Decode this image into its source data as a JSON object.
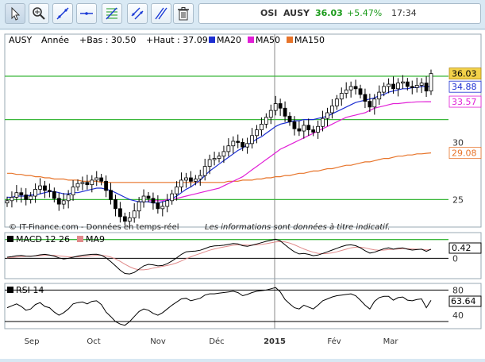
{
  "toolbar": {
    "tools": [
      {
        "name": "pointer-icon"
      },
      {
        "name": "zoom-icon"
      },
      {
        "name": "trendline-icon"
      },
      {
        "name": "horizontal-line-icon"
      },
      {
        "name": "fibonacci-icon"
      },
      {
        "name": "channel-icon"
      },
      {
        "name": "parallel-lines-icon"
      },
      {
        "name": "trash-icon"
      }
    ]
  },
  "quote": {
    "market": "OSI",
    "symbol": "AUSY",
    "price": "36.03",
    "change": "+5.47%",
    "time": "17:34",
    "change_color": "#1a9a1a"
  },
  "chart_data": [
    {
      "type": "candlestick",
      "legend": {
        "symbol": "AUSY",
        "period": "Année",
        "low": "+Bas : 30.50",
        "high": "+Haut : 37.09",
        "ma20": "MA20",
        "ma50": "MA50",
        "ma150": "MA150"
      },
      "colors": {
        "ma20": "#1d2fd1",
        "ma50": "#e11fd6",
        "ma150": "#e7742a",
        "levels": "#3bb83b"
      },
      "y_ticks": [
        "30",
        "25"
      ],
      "ylim": [
        22.8,
        38.3
      ],
      "last_labels": [
        "36.03",
        "34.88",
        "33.57",
        "29.08"
      ],
      "horizontal_levels": [
        35.8,
        32.0,
        25.0,
        21.5
      ],
      "credit": "© IT-Finance.com - Données en temps-réel",
      "disclaimer": "Les informations sont données à titre indicatif.",
      "x_labels": [
        "Sep",
        "Oct",
        "Nov",
        "Déc",
        "2015",
        "Fév",
        "Mar"
      ],
      "ohlc_close": [
        24.9,
        25.2,
        25.6,
        25.4,
        25.0,
        25.3,
        25.9,
        26.2,
        25.8,
        25.7,
        25.1,
        24.6,
        24.9,
        25.4,
        26.1,
        26.4,
        26.5,
        26.3,
        26.7,
        26.9,
        26.6,
        25.8,
        25.0,
        24.2,
        23.5,
        23.1,
        23.4,
        24.0,
        24.8,
        25.3,
        25.1,
        24.7,
        24.2,
        24.4,
        24.9,
        25.5,
        26.1,
        26.7,
        26.9,
        26.6,
        26.8,
        27.1,
        27.9,
        28.5,
        28.6,
        28.8,
        29.2,
        29.7,
        30.1,
        30.0,
        29.6,
        29.9,
        30.6,
        31.1,
        31.6,
        32.2,
        32.8,
        33.4,
        33.0,
        32.3,
        31.8,
        31.2,
        31.0,
        31.5,
        31.1,
        30.9,
        31.4,
        32.1,
        32.6,
        33.2,
        33.8,
        34.3,
        34.6,
        34.9,
        34.7,
        34.2,
        33.6,
        33.1,
        33.8,
        34.4,
        34.9,
        35.1,
        34.7,
        35.2,
        35.3,
        34.9,
        34.8,
        35.0,
        35.2,
        34.5,
        36.03
      ],
      "ma20": [
        25.2,
        25.2,
        25.3,
        25.3,
        25.3,
        25.4,
        25.4,
        25.5,
        25.6,
        25.7,
        25.7,
        25.6,
        25.5,
        25.5,
        25.6,
        25.6,
        25.7,
        25.8,
        25.9,
        26.0,
        26.0,
        25.9,
        25.8,
        25.6,
        25.4,
        25.2,
        25.0,
        24.9,
        24.8,
        24.8,
        24.8,
        24.7,
        24.7,
        24.8,
        24.9,
        25.1,
        25.3,
        25.6,
        25.9,
        26.1,
        26.4,
        26.7,
        27.1,
        27.5,
        27.8,
        28.1,
        28.4,
        28.7,
        29.0,
        29.3,
        29.5,
        29.8,
        30.0,
        30.3,
        30.5,
        30.8,
        31.1,
        31.4,
        31.6,
        31.7,
        31.8,
        31.9,
        31.9,
        32.0,
        32.0,
        32.0,
        32.1,
        32.2,
        32.3,
        32.5,
        32.7,
        32.9,
        33.1,
        33.3,
        33.5,
        33.6,
        33.7,
        33.8,
        33.9,
        34.1,
        34.2,
        34.4,
        34.5,
        34.6,
        34.7,
        34.7,
        34.8,
        34.8,
        34.9,
        34.9,
        34.88
      ],
      "ma50": [
        null,
        null,
        null,
        null,
        null,
        null,
        null,
        null,
        null,
        null,
        null,
        null,
        null,
        null,
        null,
        null,
        null,
        null,
        null,
        null,
        null,
        null,
        null,
        null,
        null,
        null,
        null,
        null,
        null,
        null,
        24.9,
        24.9,
        24.9,
        24.9,
        25.0,
        25.0,
        25.1,
        25.2,
        25.3,
        25.4,
        25.5,
        25.6,
        25.7,
        25.8,
        25.9,
        26.0,
        26.2,
        26.4,
        26.6,
        26.8,
        27.0,
        27.3,
        27.6,
        27.9,
        28.2,
        28.5,
        28.8,
        29.1,
        29.4,
        29.6,
        29.8,
        30.0,
        30.2,
        30.4,
        30.6,
        30.8,
        31.0,
        31.2,
        31.4,
        31.6,
        31.8,
        32.0,
        32.2,
        32.3,
        32.4,
        32.5,
        32.6,
        32.8,
        33.0,
        33.1,
        33.2,
        33.3,
        33.4,
        33.4,
        33.45,
        33.5,
        33.52,
        33.55,
        33.56,
        33.57,
        33.57
      ],
      "ma150": [
        27.3,
        27.3,
        27.2,
        27.2,
        27.1,
        27.1,
        27.0,
        27.0,
        26.9,
        26.9,
        26.8,
        26.8,
        26.8,
        26.7,
        26.7,
        26.7,
        26.6,
        26.6,
        26.6,
        26.6,
        26.5,
        26.5,
        26.5,
        26.5,
        26.5,
        26.5,
        26.5,
        26.5,
        26.5,
        26.5,
        26.5,
        26.5,
        26.5,
        26.5,
        26.5,
        26.5,
        26.5,
        26.5,
        26.5,
        26.5,
        26.5,
        26.5,
        26.5,
        26.5,
        26.5,
        26.5,
        26.5,
        26.6,
        26.6,
        26.6,
        26.7,
        26.7,
        26.7,
        26.8,
        26.8,
        26.9,
        26.9,
        27.0,
        27.0,
        27.1,
        27.1,
        27.2,
        27.3,
        27.3,
        27.4,
        27.5,
        27.5,
        27.6,
        27.7,
        27.7,
        27.8,
        27.9,
        28.0,
        28.0,
        28.1,
        28.2,
        28.3,
        28.3,
        28.4,
        28.5,
        28.6,
        28.6,
        28.7,
        28.8,
        28.8,
        28.9,
        28.9,
        29.0,
        29.0,
        29.05,
        29.08
      ]
    },
    {
      "type": "line",
      "legend": {
        "macd": "MACD 12 26",
        "ma9": "MA9"
      },
      "ylim": [
        -0.9,
        1.0
      ],
      "y_ticks": [
        "0"
      ],
      "last_label": "0.42",
      "macd": [
        0.05,
        0.08,
        0.12,
        0.13,
        0.1,
        0.09,
        0.12,
        0.16,
        0.18,
        0.15,
        0.1,
        0.02,
        -0.03,
        0.0,
        0.05,
        0.1,
        0.14,
        0.16,
        0.18,
        0.19,
        0.14,
        0.02,
        -0.15,
        -0.35,
        -0.55,
        -0.7,
        -0.72,
        -0.65,
        -0.5,
        -0.35,
        -0.28,
        -0.3,
        -0.35,
        -0.33,
        -0.25,
        -0.12,
        0.02,
        0.18,
        0.3,
        0.32,
        0.33,
        0.37,
        0.45,
        0.53,
        0.57,
        0.58,
        0.6,
        0.64,
        0.68,
        0.66,
        0.58,
        0.55,
        0.6,
        0.66,
        0.72,
        0.78,
        0.83,
        0.88,
        0.8,
        0.62,
        0.45,
        0.3,
        0.2,
        0.22,
        0.18,
        0.12,
        0.15,
        0.22,
        0.3,
        0.38,
        0.46,
        0.54,
        0.6,
        0.62,
        0.58,
        0.48,
        0.35,
        0.24,
        0.28,
        0.36,
        0.44,
        0.48,
        0.42,
        0.46,
        0.48,
        0.42,
        0.38,
        0.4,
        0.42,
        0.32,
        0.42
      ],
      "ma9": [
        0.02,
        0.04,
        0.06,
        0.08,
        0.09,
        0.1,
        0.11,
        0.12,
        0.13,
        0.14,
        0.13,
        0.11,
        0.09,
        0.07,
        0.06,
        0.07,
        0.08,
        0.1,
        0.12,
        0.14,
        0.14,
        0.11,
        0.06,
        -0.03,
        -0.14,
        -0.27,
        -0.39,
        -0.48,
        -0.53,
        -0.53,
        -0.5,
        -0.45,
        -0.41,
        -0.37,
        -0.33,
        -0.28,
        -0.21,
        -0.12,
        -0.02,
        0.07,
        0.15,
        0.22,
        0.3,
        0.37,
        0.43,
        0.48,
        0.52,
        0.56,
        0.6,
        0.62,
        0.62,
        0.61,
        0.61,
        0.62,
        0.64,
        0.67,
        0.71,
        0.75,
        0.77,
        0.75,
        0.7,
        0.62,
        0.52,
        0.43,
        0.35,
        0.28,
        0.23,
        0.21,
        0.22,
        0.25,
        0.3,
        0.36,
        0.42,
        0.48,
        0.51,
        0.51,
        0.48,
        0.43,
        0.39,
        0.37,
        0.38,
        0.4,
        0.41,
        0.43,
        0.44,
        0.44,
        0.43,
        0.42,
        0.41,
        0.39,
        0.4
      ]
    },
    {
      "type": "line",
      "legend": {
        "rsi": "RSI 14"
      },
      "ylim": [
        20,
        88
      ],
      "y_ticks": [
        "80",
        "40"
      ],
      "levels": [
        80,
        30
      ],
      "last_label": "63.64",
      "rsi": [
        52,
        55,
        58,
        54,
        48,
        50,
        57,
        60,
        54,
        52,
        45,
        40,
        44,
        50,
        58,
        60,
        61,
        58,
        62,
        63,
        57,
        45,
        38,
        30,
        26,
        24,
        30,
        38,
        46,
        50,
        48,
        43,
        40,
        44,
        50,
        56,
        61,
        66,
        67,
        63,
        65,
        67,
        72,
        74,
        74,
        75,
        76,
        77,
        78,
        76,
        71,
        73,
        76,
        78,
        79,
        80,
        82,
        84,
        77,
        65,
        58,
        52,
        50,
        56,
        53,
        50,
        56,
        63,
        66,
        69,
        71,
        72,
        73,
        74,
        71,
        64,
        56,
        50,
        62,
        68,
        70,
        70,
        64,
        68,
        69,
        64,
        63,
        65,
        66,
        52,
        63.64
      ]
    }
  ]
}
